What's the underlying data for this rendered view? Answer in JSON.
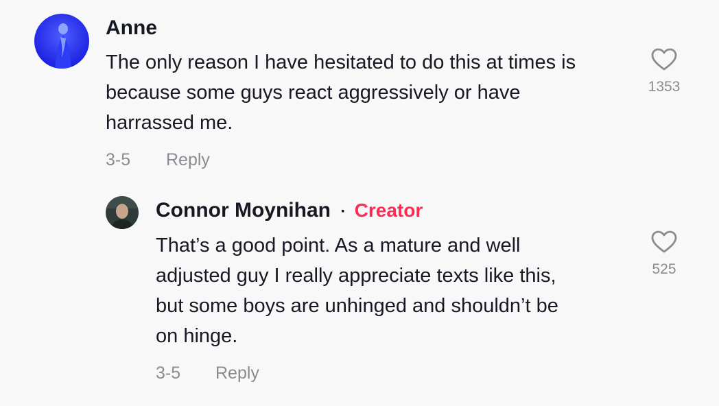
{
  "comments": [
    {
      "author": "Anne",
      "text_lines": [
        "The only reason I have hesitated to do this at times is",
        "because some guys react aggressively or have",
        "harrassed me."
      ],
      "date": "3-5",
      "reply_label": "Reply",
      "likes": "1353"
    }
  ],
  "replies": [
    {
      "author": "Connor Moynihan",
      "separator": "·",
      "badge": "Creator",
      "text_lines": [
        "That’s a good point. As a mature and well",
        "adjusted guy I really appreciate texts like this,",
        "but some boys are unhinged and shouldn’t be",
        "on hinge."
      ],
      "date": "3-5",
      "reply_label": "Reply",
      "likes": "525"
    }
  ],
  "colors": {
    "background": "#f8f8f8",
    "text": "#161823",
    "muted": "#8a8b91",
    "creator_badge": "#fe2c55"
  }
}
